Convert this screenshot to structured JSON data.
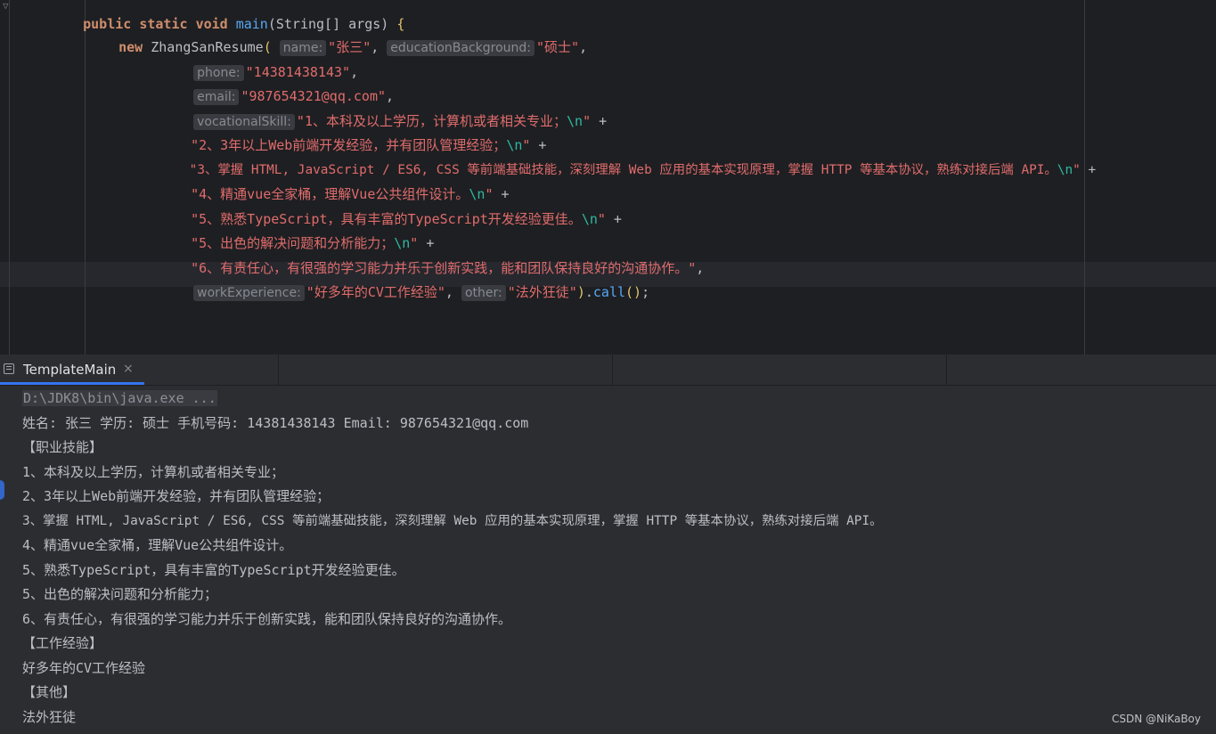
{
  "editor": {
    "line1": {
      "kw1": "public",
      "kw2": "static",
      "kw3": "void",
      "fn": "main",
      "type": "String[]",
      "param": "args",
      "brace": "{"
    },
    "line2": {
      "kw": "new",
      "cls": "ZhangSanResume",
      "hint_name": "name:",
      "val_name": "\"张三\"",
      "hint_edu": "educationBackground:",
      "val_edu": "\"硕士\""
    },
    "line3": {
      "hint": "phone:",
      "val": "\"14381438143\""
    },
    "line4": {
      "hint": "email:",
      "val": "\"987654321@qq.com\""
    },
    "line5": {
      "hint": "vocationalSkill:",
      "val": "\"1、本科及以上学历，计算机或者相关专业；",
      "esc": "\\n",
      "end": "\""
    },
    "line6": {
      "val": "\"2、3年以上Web前端开发经验，并有团队管理经验；",
      "esc": "\\n",
      "end": "\""
    },
    "line7": {
      "val": "\"3、掌握 HTML, JavaScript / ES6, CSS 等前端基础技能，深刻理解 Web 应用的基本实现原理，掌握 HTTP 等基本协议，熟练对接后端 API。",
      "esc": "\\n",
      "end": "\""
    },
    "line8": {
      "val": "\"4、精通vue全家桶，理解Vue公共组件设计。",
      "esc": "\\n",
      "end": "\""
    },
    "line9": {
      "val": "\"5、熟悉TypeScript，具有丰富的TypeScript开发经验更佳。",
      "esc": "\\n",
      "end": "\""
    },
    "line10": {
      "val": "\"5、出色的解决问题和分析能力；",
      "esc": "\\n",
      "end": "\""
    },
    "line11": {
      "val": "\"6、有责任心，有很强的学习能力并乐于创新实践，能和团队保持良好的沟通协作。\""
    },
    "line12": {
      "hint_work": "workExperience:",
      "val_work": "\"好多年的CV工作经验\"",
      "hint_other": "other:",
      "val_other": "\"法外狂徒\"",
      "call": "call"
    }
  },
  "run_tab": {
    "label": "TemplateMain",
    "close": "×"
  },
  "console": {
    "command": "D:\\JDK8\\bin\\java.exe ...",
    "lines": [
      "姓名: 张三 学历: 硕士 手机号码: 14381438143 Email: 987654321@qq.com",
      "【职业技能】",
      "1、本科及以上学历，计算机或者相关专业；",
      "2、3年以上Web前端开发经验，并有团队管理经验；",
      "3、掌握 HTML, JavaScript / ES6, CSS 等前端基础技能，深刻理解 Web 应用的基本实现原理，掌握 HTTP 等基本协议，熟练对接后端 API。",
      "4、精通vue全家桶，理解Vue公共组件设计。",
      "5、熟悉TypeScript，具有丰富的TypeScript开发经验更佳。",
      "5、出色的解决问题和分析能力；",
      "6、有责任心，有很强的学习能力并乐于创新实践，能和团队保持良好的沟通协作。",
      "【工作经验】",
      "好多年的CV工作经验",
      "【其他】",
      "法外狂徒"
    ]
  },
  "watermark": "CSDN @NiKaBoy",
  "colors": {
    "editor_bg": "#1e1f22",
    "panel_bg": "#2b2d30",
    "keyword": "#cf8e6d",
    "string": "#e06c6c",
    "method": "#56a8f5",
    "escape": "#2fbaa3",
    "accent": "#3574f0"
  }
}
